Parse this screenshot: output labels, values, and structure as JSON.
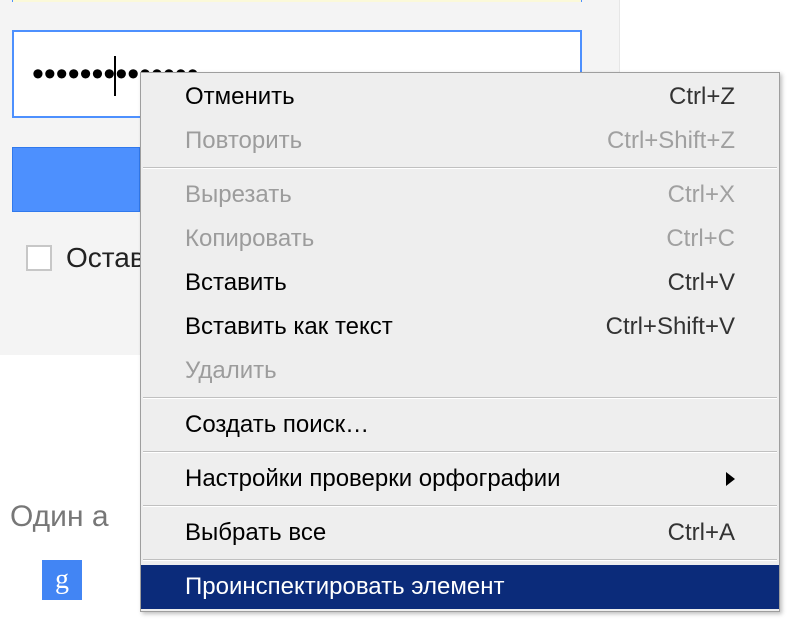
{
  "form": {
    "password_mask_left": "•••••••",
    "password_mask_right": "•••••••",
    "stay_label": "Остав",
    "signin_label": ""
  },
  "lower": {
    "one_account": "Один а",
    "g": "g"
  },
  "context_menu": {
    "items": [
      {
        "label": "Отменить",
        "shortcut": "Ctrl+Z",
        "enabled": true
      },
      {
        "label": "Повторить",
        "shortcut": "Ctrl+Shift+Z",
        "enabled": false
      },
      {
        "sep": true
      },
      {
        "label": "Вырезать",
        "shortcut": "Ctrl+X",
        "enabled": false
      },
      {
        "label": "Копировать",
        "shortcut": "Ctrl+C",
        "enabled": false
      },
      {
        "label": "Вставить",
        "shortcut": "Ctrl+V",
        "enabled": true
      },
      {
        "label": "Вставить как текст",
        "shortcut": "Ctrl+Shift+V",
        "enabled": true
      },
      {
        "label": "Удалить",
        "shortcut": "",
        "enabled": false
      },
      {
        "sep": true
      },
      {
        "label": "Создать поиск…",
        "shortcut": "",
        "enabled": true
      },
      {
        "sep": true
      },
      {
        "label": "Настройки проверки орфографии",
        "shortcut": "",
        "enabled": true,
        "submenu": true
      },
      {
        "sep": true
      },
      {
        "label": "Выбрать все",
        "shortcut": "Ctrl+A",
        "enabled": true
      },
      {
        "sep": true
      },
      {
        "label": "Проинспектировать элемент",
        "shortcut": "",
        "enabled": true,
        "highlight": true
      }
    ]
  }
}
